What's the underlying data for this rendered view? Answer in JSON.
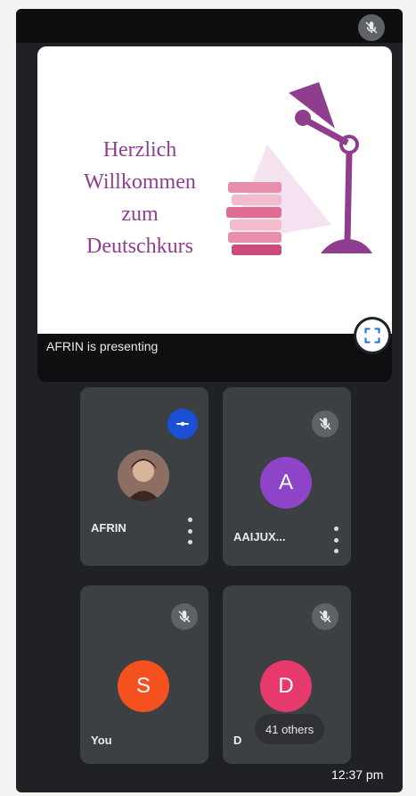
{
  "presentation": {
    "slide_title": "Herzlich\nWillkommen\nzum\nDeutschkurs",
    "caption": "AFRIN is presenting",
    "fullscreen_icon": "fullscreen-icon"
  },
  "participants": [
    {
      "name": "AFRIN",
      "avatar_type": "photo",
      "pinned": true,
      "muted": false
    },
    {
      "name": "AAIJUX...",
      "initial": "A",
      "color": "#8e44c9",
      "muted": true
    },
    {
      "name": "You",
      "initial": "S",
      "color": "#f4511e",
      "muted": true
    },
    {
      "name": "D",
      "initial": "D",
      "color": "#e53a6b",
      "muted": true
    }
  ],
  "others_label": "41 others",
  "clock": "12:37 pm",
  "colors": {
    "background": "#202124",
    "tile": "#3c4043",
    "accent": "#1a4fd6",
    "slide_purple": "#8e3e8c"
  }
}
